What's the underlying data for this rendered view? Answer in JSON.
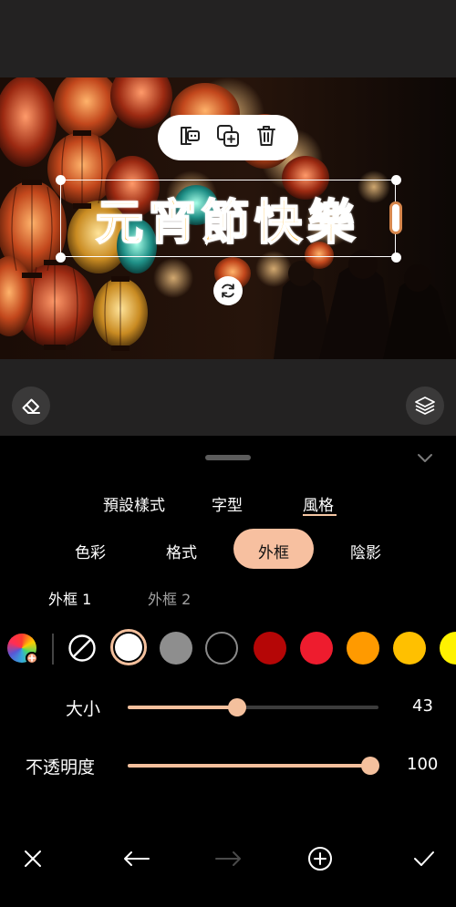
{
  "canvas": {
    "overlay_text": "元宵節快樂",
    "text_fill_color": "#ffb21a",
    "text_outline_color": "#ffffff"
  },
  "floating_toolbar": {
    "icons": [
      "text-edit-icon",
      "duplicate-icon",
      "trash-icon"
    ]
  },
  "canvas_tools": {
    "left_icon": "eraser-icon",
    "right_icon": "layers-icon"
  },
  "main_tabs": [
    {
      "label": "預設樣式",
      "active": false
    },
    {
      "label": "字型",
      "active": false
    },
    {
      "label": "風格",
      "active": true
    }
  ],
  "sub_tabs": [
    {
      "label": "色彩",
      "active": false
    },
    {
      "label": "格式",
      "active": false
    },
    {
      "label": "外框",
      "active": true
    },
    {
      "label": "陰影",
      "active": false
    }
  ],
  "outline_tabs": [
    {
      "label": "外框 1",
      "active": true
    },
    {
      "label": "外框 2",
      "active": false
    }
  ],
  "swatches": [
    {
      "type": "picker"
    },
    {
      "type": "none"
    },
    {
      "type": "color",
      "color": "#ffffff",
      "selected": true
    },
    {
      "type": "color",
      "color": "#8e8e8e"
    },
    {
      "type": "color",
      "color": "#000000",
      "ring": true
    },
    {
      "type": "color",
      "color": "#b50606"
    },
    {
      "type": "color",
      "color": "#ee1c2e"
    },
    {
      "type": "color",
      "color": "#ff9a00"
    },
    {
      "type": "color",
      "color": "#ffc000"
    },
    {
      "type": "color",
      "color": "#fff200"
    }
  ],
  "size_slider": {
    "label": "大小",
    "value": "43",
    "fraction": 0.43
  },
  "opacity_slider": {
    "label": "不透明度",
    "value": "100",
    "fraction": 1.0
  },
  "bottom_bar": {
    "icons": [
      "close-icon",
      "undo-icon",
      "redo-icon",
      "add-icon",
      "check-icon"
    ],
    "redo_enabled": false
  },
  "colors": {
    "accent": "#f4c09d",
    "panel_bg": "#000000",
    "band_bg": "#232222"
  }
}
